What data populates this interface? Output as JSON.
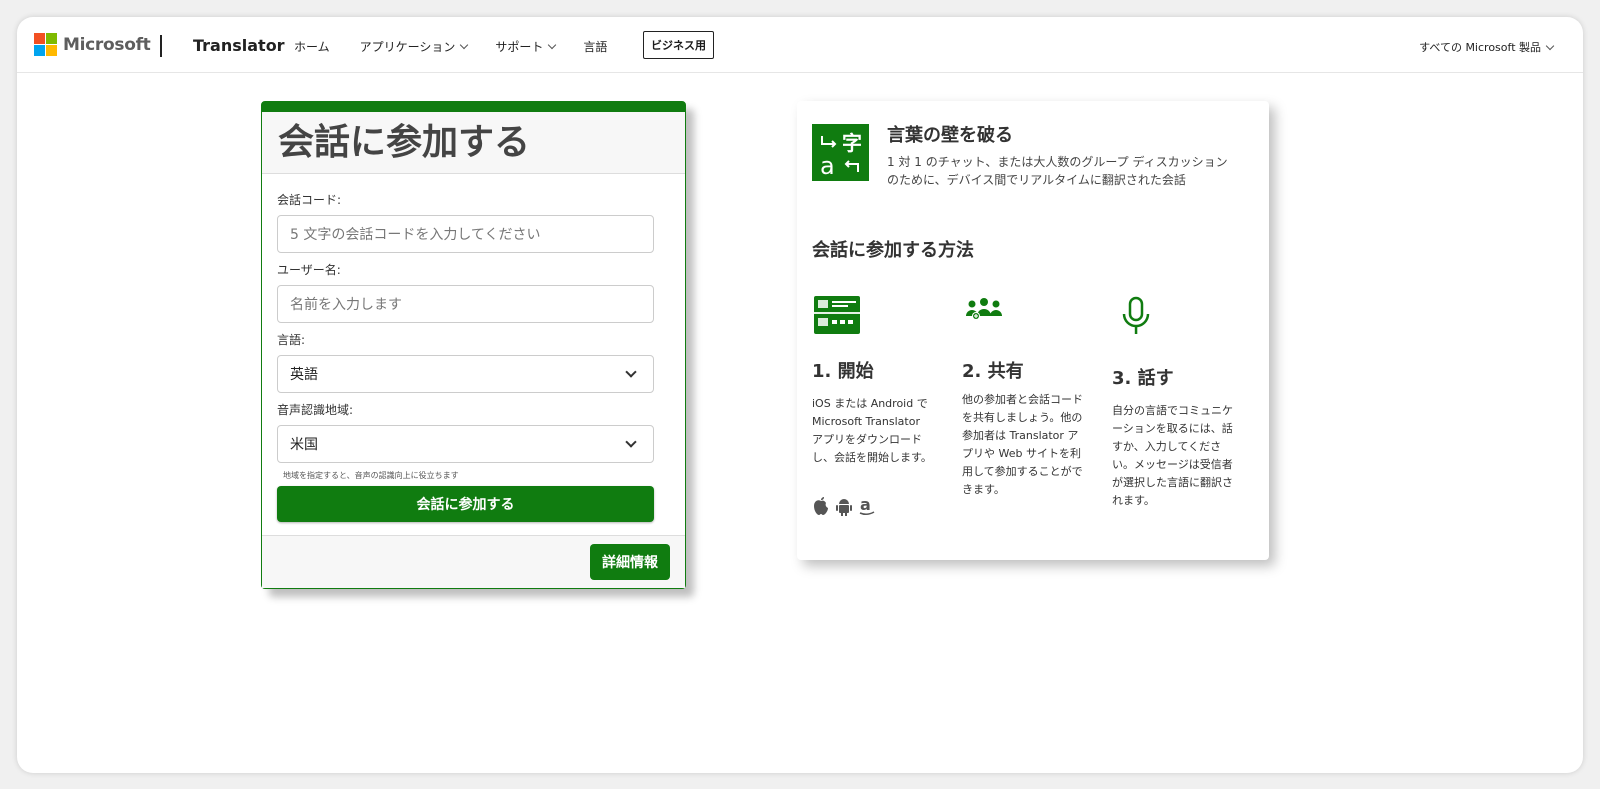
{
  "colors": {
    "accent": "#107c10",
    "ms_red": "#f25022",
    "ms_green": "#7fba00",
    "ms_blue": "#00a4ef",
    "ms_yellow": "#ffb900"
  },
  "header": {
    "logo_text": "Microsoft",
    "brand": "Translator",
    "nav": [
      {
        "label": "ホーム",
        "has_dropdown": false
      },
      {
        "label": "アプリケーション",
        "has_dropdown": true
      },
      {
        "label": "サポート",
        "has_dropdown": true
      },
      {
        "label": "言語",
        "has_dropdown": false
      }
    ],
    "business_button": "ビジネス用",
    "all_products": "すべての Microsoft 製品"
  },
  "join": {
    "title": "会話に参加する",
    "code_label": "会話コード:",
    "code_placeholder": "5 文字の会話コードを入力してください",
    "name_label": "ユーザー名:",
    "name_placeholder": "名前を入力します",
    "language_label": "言語:",
    "language_value": "英語",
    "region_label": "音声認識地域:",
    "region_value": "米国",
    "region_hint": "地域を指定すると、音声の認識向上に役立ちます",
    "join_button": "会話に参加する",
    "more_info_button": "詳細情報"
  },
  "info": {
    "logo_icon": "translator-logo-icon",
    "hero_title": "言葉の壁を破る",
    "hero_desc": "1 対 1 のチャット、または大人数のグループ ディスカッションのために、デバイス間でリアルタイムに翻訳された会話",
    "how_title": "会話に参加する方法",
    "steps": [
      {
        "icon": "app-window-icon",
        "title": "1. 開始",
        "desc": "iOS または Android で Microsoft Translator アプリをダウンロードし、会話を開始します。"
      },
      {
        "icon": "group-icon",
        "title": "2. 共有",
        "desc": "他の参加者と会話コードを共有しましょう。他の参加者は Translator アプリや Web サイトを利用して参加することができます。"
      },
      {
        "icon": "microphone-icon",
        "title": "3. 話す",
        "desc": "自分の言語でコミュニケーションを取るには、話すか、入力してください。メッセージは受信者が選択した言語に翻訳されます。"
      }
    ],
    "store_icons": [
      "apple-icon",
      "android-icon",
      "amazon-icon"
    ]
  }
}
